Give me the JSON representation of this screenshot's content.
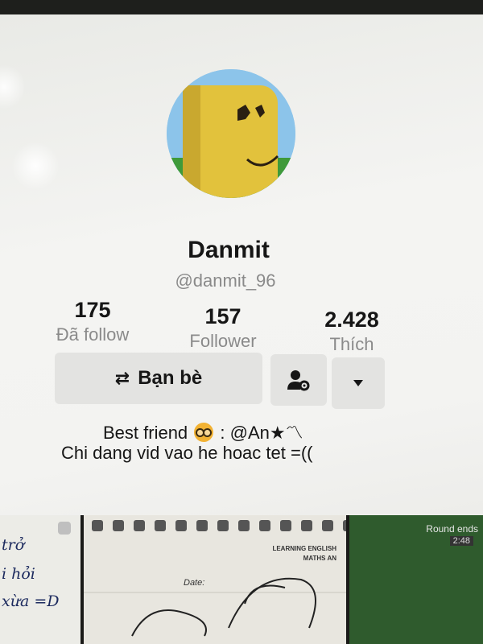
{
  "profile": {
    "display_name": "Danmit",
    "handle": "@danmit_96"
  },
  "stats": {
    "following": {
      "value": "175",
      "label": "Đã follow"
    },
    "followers": {
      "value": "157",
      "label": "Follower"
    },
    "likes": {
      "value": "2.428",
      "label": "Thích"
    }
  },
  "actions": {
    "friends_label": "Bạn bè",
    "friends_icon": "swap-arrows-icon",
    "settings_icon": "person-gear-icon",
    "more_icon": "caret-down-icon"
  },
  "bio": {
    "line1_prefix": "Best friend",
    "line1_suffix": ": @An★〽",
    "line2": "Chi dang vid vao he hoac tet =(("
  },
  "videos": {
    "tile1_lines": [
      "trở",
      "i hỏi",
      "xừa =D"
    ],
    "tile2_caption_line1": "LEARNING ENGLISH",
    "tile2_caption_line2": "MATHS AN",
    "tile2_date_label": "Date:",
    "tile3_title": "Round ends",
    "tile3_time": "2:48"
  },
  "colors": {
    "background": "#f3f3f1",
    "button_bg": "#e3e3e1",
    "primary_text": "#161616",
    "secondary_text": "#8a8a8a"
  }
}
